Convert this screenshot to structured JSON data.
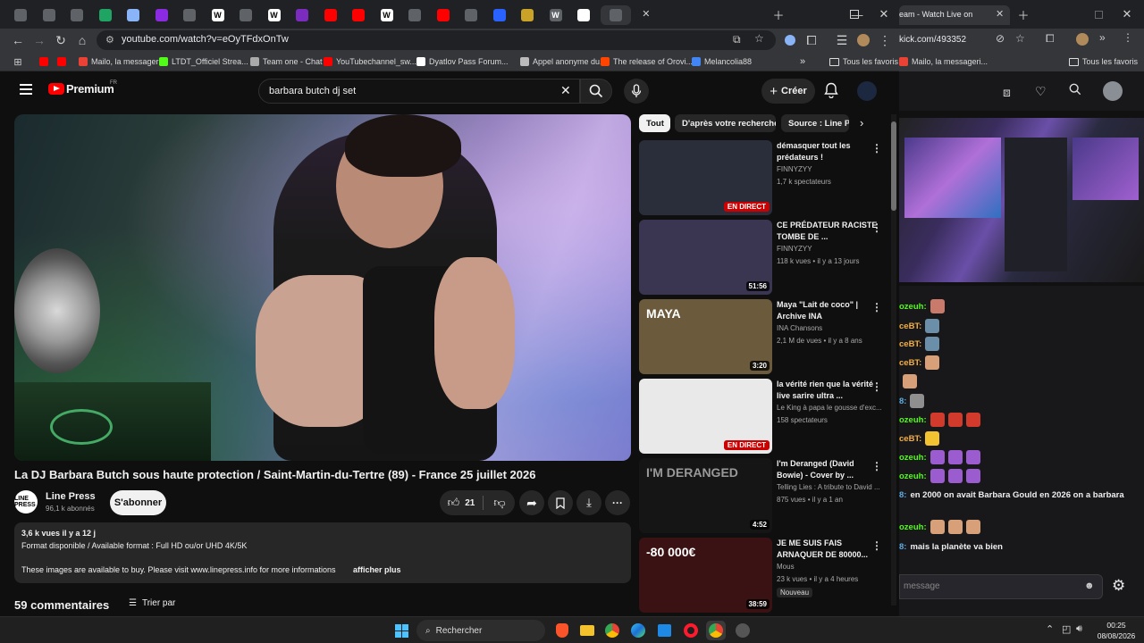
{
  "left_browser": {
    "url": "youtube.com/watch?v=eOyTFdxOnTw",
    "tab_letters": [
      "",
      "",
      "",
      "",
      "",
      "",
      "",
      "W",
      "",
      "W",
      "",
      "",
      "",
      "W",
      "",
      "",
      "",
      "",
      "",
      "W",
      "",
      ""
    ],
    "bookmarks": [
      {
        "label": "Mailo, la messageri...",
        "color": "#ea4335"
      },
      {
        "label": "LTDT_Officiel Strea...",
        "color": "#53fc18"
      },
      {
        "label": "Team one - Chat",
        "color": "#aaaaaa"
      },
      {
        "label": "YouTubechannel_sw...",
        "color": "#ff0000"
      },
      {
        "label": "Dyatlov Pass Forum...",
        "color": "#ffffff"
      },
      {
        "label": "Appel anonyme du...",
        "color": "#bbbbbb"
      },
      {
        "label": "The release of Orovi...",
        "color": "#ff4500"
      },
      {
        "label": "Melancolia88",
        "color": "#4285f4"
      }
    ],
    "bookmarks_folder": "Tous les favoris",
    "bookmarks_more": "»"
  },
  "youtube": {
    "logo_text": "Premium",
    "logo_badge": "FR",
    "search_value": "barbara butch dj set",
    "create_label": "Créer",
    "video": {
      "title": "La DJ Barbara Butch sous haute protection / Saint-Martin-du-Tertre (89) - France 25 juillet 2026",
      "channel": "Line Press",
      "channel_avatar_text": "LINE PRESS",
      "subscribers": "96,1 k abonnés",
      "subscribe_label": "S'abonner",
      "likes": "21",
      "views_age": "3,6 k vues  il y a 12 j",
      "desc_line1": "Format disponible / Available format : Full HD ou/or UHD 4K/5K",
      "desc_line2": "These images are available to buy. Please visit www.linepress.info for more informations",
      "more_label": "afficher plus",
      "comments_label": "59 commentaires",
      "sort_label": "Trier par"
    },
    "chips": [
      "Tout",
      "D'après votre recherche",
      "Source : Line Pr"
    ],
    "recommendations": [
      {
        "title": "démasquer tout les prédateurs !",
        "channel": "FINNYZYY",
        "meta": "1,7 k spectateurs",
        "badge": "EN DIRECT",
        "badge_type": "live",
        "thumb": "#2a2d3a"
      },
      {
        "title": "CE PRÉDATEUR RACISTE TOMBE DE ...",
        "channel": "FINNYZYY",
        "meta": "118 k vues • il y a 13 jours",
        "badge": "51:56",
        "badge_type": "dur",
        "thumb": "#3a3550"
      },
      {
        "title": "Maya \"Lait de coco\" | Archive INA",
        "channel": "INA Chansons",
        "meta": "2,1 M de vues • il y a 8 ans",
        "badge": "3:20",
        "badge_type": "dur",
        "thumb": "#6b5a3c",
        "thumb_text": "MAYA"
      },
      {
        "title": "la vérité rien que la vérité live sarire ultra ...",
        "channel": "Le King à papa le gousse d'exc...",
        "meta": "158 spectateurs",
        "badge": "EN DIRECT",
        "badge_type": "live",
        "thumb": "#e9e9e9"
      },
      {
        "title": "I'm Deranged (David Bowie) - Cover by ...",
        "channel": "Telling Lies : A tribute to David ...",
        "meta": "875 vues • il y a 1 an",
        "badge": "4:52",
        "badge_type": "dur",
        "thumb": "#151515",
        "thumb_text": "I'M DERANGED"
      },
      {
        "title": "JE ME SUIS FAIS ARNAQUER DE 80000...",
        "channel": "Mous",
        "meta": "23 k vues • il y a 4 heures",
        "badge": "38:59",
        "badge_type": "dur",
        "thumb": "#3b1214",
        "thumb_text": "-80 000€",
        "tag": "Nouveau"
      }
    ]
  },
  "right_browser": {
    "tab_title": "eam - Watch Live on",
    "url": "kick.com/493352",
    "bookmark1": "Mailo, la messageri...",
    "bookmarks_folder": "Tous les favoris",
    "chat": [
      {
        "user": "ozeuh:",
        "text": "",
        "emotes": [
          "#c97a6a"
        ],
        "color": "#53fc18"
      },
      {
        "user": "ceBT:",
        "text": "",
        "emotes": [
          "#6b8fa8"
        ],
        "color": "#f5b041"
      },
      {
        "user": "ceBT:",
        "text": "",
        "emotes": [
          "#6b8fa8"
        ],
        "color": "#f5b041"
      },
      {
        "user": "ceBT:",
        "text": "",
        "emotes": [
          "#d8a078"
        ],
        "color": "#f5b041"
      },
      {
        "user": "",
        "text": "",
        "emotes": [
          "#d8a078"
        ],
        "color": "#f5b041"
      },
      {
        "user": "8:",
        "text": "",
        "emotes": [
          "#8f8f8f"
        ],
        "color": "#5dade2"
      },
      {
        "user": "ozeuh:",
        "text": "",
        "emotes": [
          "#d23b2b",
          "#d23b2b",
          "#d23b2b"
        ],
        "color": "#53fc18"
      },
      {
        "user": "ceBT:",
        "text": "",
        "emotes": [
          "#f2c230"
        ],
        "color": "#f5b041"
      },
      {
        "user": "ozeuh:",
        "text": "",
        "emotes": [
          "#9b5cd0",
          "#9b5cd0",
          "#9b5cd0"
        ],
        "color": "#53fc18"
      },
      {
        "user": "ozeuh:",
        "text": "",
        "emotes": [
          "#9b5cd0",
          "#9b5cd0",
          "#9b5cd0"
        ],
        "color": "#53fc18"
      },
      {
        "user": "8:",
        "text": "en 2000 on avait Barbara Gould en 2026 on a barbara",
        "emotes": [],
        "color": "#5dade2"
      },
      {
        "user": "ozeuh:",
        "text": "",
        "emotes": [
          "#d8a078",
          "#d8a078",
          "#d8a078"
        ],
        "color": "#53fc18"
      },
      {
        "user": "8:",
        "text": "mais la planète va bien",
        "emotes": [],
        "color": "#5dade2"
      }
    ],
    "chat_placeholder": "message"
  },
  "taskbar": {
    "search_label": "Rechercher",
    "time": "00:25",
    "date": "08/08/2026"
  }
}
